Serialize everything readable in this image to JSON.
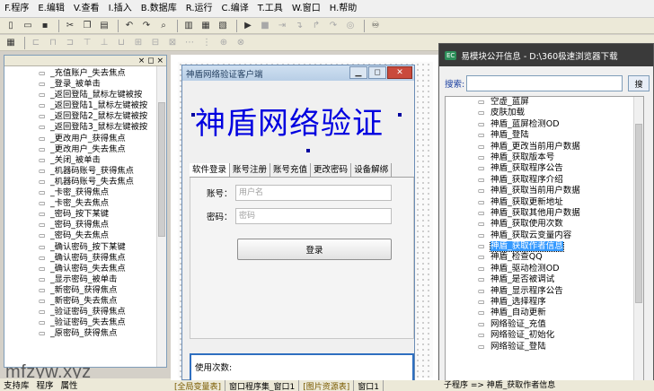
{
  "menu": [
    "F.程序",
    "E.编辑",
    "V.查看",
    "I.插入",
    "B.数据库",
    "R.运行",
    "C.编译",
    "T.工具",
    "W.窗口",
    "H.帮助"
  ],
  "left_panel": {
    "close_glyph": "× ◻ ×",
    "items": [
      "_充值账户_失去焦点",
      "_登录_被单击",
      "_返回登陆_鼠标左键被按",
      "_返回登陆1_鼠标左键被按",
      "_返回登陆2_鼠标左键被按",
      "_返回登陆3_鼠标左键被按",
      "_更改用户_获得焦点",
      "_更改用户_失去焦点",
      "_关闭_被单击",
      "_机器码账号_获得焦点",
      "_机器码账号_失去焦点",
      "_卡密_获得焦点",
      "_卡密_失去焦点",
      "_密码_按下某键",
      "_密码_获得焦点",
      "_密码_失去焦点",
      "_确认密码_按下某键",
      "_确认密码_获得焦点",
      "_确认密码_失去焦点",
      "_显示密码_被单击",
      "_新密码_获得焦点",
      "_新密码_失去焦点",
      "_验证密码_获得焦点",
      "_验证密码_失去焦点",
      "_原密码_获得焦点"
    ]
  },
  "bottom_tabs": [
    "支持库",
    "程序",
    "属性"
  ],
  "watermark": "mfzyw.xyz",
  "form": {
    "title": "神盾网络验证客户端",
    "big_title": "神盾网络验证",
    "tabs": [
      "软件登录",
      "账号注册",
      "账号充值",
      "更改密码",
      "设备解绑"
    ],
    "account_label": "账号：",
    "account_placeholder": "用户名",
    "password_label": "密码：",
    "password_placeholder": "密码",
    "login_button": "登录",
    "usage_label": "使用次数:"
  },
  "right_window": {
    "badge": "EC",
    "title": "易模块公开信息 - D:\\360极速浏览器下载",
    "search_label": "搜索:",
    "search_button": "搜",
    "items": [
      "空虚_蓝屏",
      "皮肤加载",
      "神盾_蓝屏检测OD",
      "神盾_登陆",
      "神盾_更改当前用户数据",
      "神盾_获取版本号",
      "神盾_获取程序公告",
      "神盾_获取程序介绍",
      "神盾_获取当前用户数据",
      "神盾_获取更新地址",
      "神盾_获取其他用户数据",
      "神盾_获取使用次数",
      "神盾_获取云变量内容",
      "神盾_获取作者信息",
      "神盾_检查QQ",
      "神盾_驱动检测OD",
      "神盾_是否被调试",
      "神盾_显示程序公告",
      "神盾_选择程序",
      "神盾_自动更新",
      "网络验证_充值",
      "网络验证_初始化",
      "网络验证_登陆"
    ],
    "highlighted": "神盾_获取作者信息"
  },
  "status": [
    "[全局变量表]",
    "窗口程序集_窗口1",
    "[图片资源表]",
    "窗口1"
  ],
  "status_right": "子程序 => 神盾_获取作者信息"
}
